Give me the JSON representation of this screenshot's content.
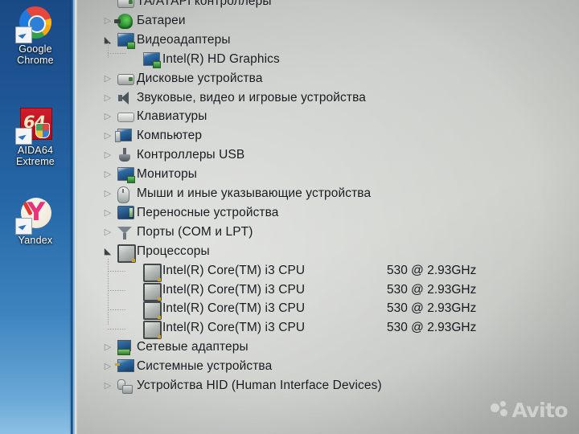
{
  "desktop": {
    "icons": [
      {
        "name": "google-chrome",
        "label": "Google\nChrome",
        "label_line1": "Google",
        "label_line2": "Chrome"
      },
      {
        "name": "aida64-extreme",
        "label": "AIDA64\nExtreme",
        "label_line1": "AIDA64",
        "label_line2": "Extreme"
      },
      {
        "name": "yandex",
        "label": "Yandex",
        "label_line1": "Yandex",
        "label_line2": ""
      }
    ]
  },
  "device_manager": {
    "rows": [
      {
        "label": "ТА/АТАРI контроллеры",
        "icon": "ide-controller-icon",
        "depth": 1,
        "twisty": "none",
        "clipped_top": true
      },
      {
        "label": "Батареи",
        "icon": "battery-icon",
        "depth": 1,
        "twisty": "closed"
      },
      {
        "label": "Видеоадаптеры",
        "icon": "display-adapter-icon",
        "depth": 1,
        "twisty": "open"
      },
      {
        "label": "Intel(R) HD Graphics",
        "icon": "display-adapter-icon",
        "depth": 2,
        "twisty": "none"
      },
      {
        "label": "Дисковые устройства",
        "icon": "disk-drive-icon",
        "depth": 1,
        "twisty": "closed"
      },
      {
        "label": "Звуковые, видео и игровые устройства",
        "icon": "speaker-icon",
        "depth": 1,
        "twisty": "closed"
      },
      {
        "label": "Клавиатуры",
        "icon": "keyboard-icon",
        "depth": 1,
        "twisty": "closed"
      },
      {
        "label": "Компьютер",
        "icon": "computer-icon",
        "depth": 1,
        "twisty": "closed"
      },
      {
        "label": "Контроллеры USB",
        "icon": "usb-icon",
        "depth": 1,
        "twisty": "closed"
      },
      {
        "label": "Мониторы",
        "icon": "monitor-icon",
        "depth": 1,
        "twisty": "closed"
      },
      {
        "label": "Мыши и иные указывающие устройства",
        "icon": "mouse-icon",
        "depth": 1,
        "twisty": "closed"
      },
      {
        "label": "Переносные устройства",
        "icon": "portable-device-icon",
        "depth": 1,
        "twisty": "closed"
      },
      {
        "label": "Порты (COM и LPT)",
        "icon": "port-icon",
        "depth": 1,
        "twisty": "closed"
      },
      {
        "label": "Процессоры",
        "icon": "cpu-icon",
        "depth": 1,
        "twisty": "open"
      },
      {
        "label": "Intel(R) Core(TM) i3 CPU",
        "spec": "530  @ 2.93GHz",
        "icon": "cpu-icon",
        "depth": 2,
        "twisty": "none"
      },
      {
        "label": "Intel(R) Core(TM) i3 CPU",
        "spec": "530  @ 2.93GHz",
        "icon": "cpu-icon",
        "depth": 2,
        "twisty": "none"
      },
      {
        "label": "Intel(R) Core(TM) i3 CPU",
        "spec": "530  @ 2.93GHz",
        "icon": "cpu-icon",
        "depth": 2,
        "twisty": "none"
      },
      {
        "label": "Intel(R) Core(TM) i3 CPU",
        "spec": "530  @ 2.93GHz",
        "icon": "cpu-icon",
        "depth": 2,
        "twisty": "none"
      },
      {
        "label": "Сетевые адаптеры",
        "icon": "network-adapter-icon",
        "depth": 1,
        "twisty": "closed"
      },
      {
        "label": "Системные устройства",
        "icon": "system-device-icon",
        "depth": 1,
        "twisty": "closed"
      },
      {
        "label": "Устройства HID (Human Interface Devices)",
        "icon": "hid-icon",
        "depth": 1,
        "twisty": "closed"
      }
    ]
  },
  "watermark": {
    "text": "Avito"
  },
  "colors": {
    "desktop_blue": "#1d5391",
    "panel_grey": "#c9ccc8",
    "text": "#161a1e",
    "accent_green": "#2c7a2a",
    "accent_blue": "#2f6ea8"
  }
}
